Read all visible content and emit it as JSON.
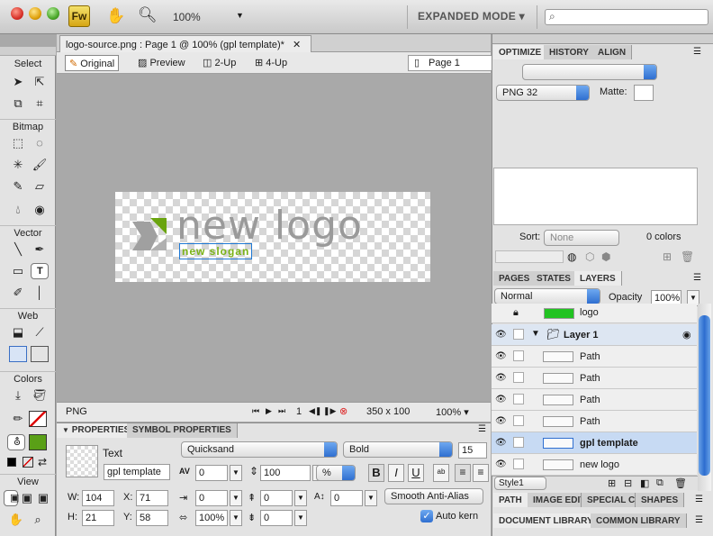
{
  "app": {
    "logo": "Fw",
    "zoom": "100%",
    "mode": "EXPANDED MODE"
  },
  "document": {
    "tab_title": "logo-source.png : Page 1 @ 100% (gpl template)*",
    "views": [
      "Original",
      "Preview",
      "2-Up",
      "4-Up"
    ],
    "page_select": "Page 1",
    "canvas_logo_text": "new logo",
    "canvas_slogan_text": "new slogan"
  },
  "tools": {
    "sections": [
      "Select",
      "Bitmap",
      "Vector",
      "Web",
      "Colors",
      "View"
    ]
  },
  "status": {
    "format": "PNG",
    "frame": "1",
    "size": "350 x 100",
    "zoom": "100%"
  },
  "properties": {
    "tabs": [
      "PROPERTIES",
      "SYMBOL PROPERTIES"
    ],
    "object_type": "Text",
    "object_name": "gpl template",
    "font": "Quicksand",
    "style": "Bold",
    "size": "15",
    "tracking": "0",
    "leading": "100",
    "leading_unit": "%",
    "w_label": "W:",
    "w": "104",
    "x_label": "X:",
    "x": "71",
    "h_label": "H:",
    "h": "21",
    "y_label": "Y:",
    "y": "58",
    "indent": "0",
    "space_before": "0",
    "baseline_shift": "0",
    "horiz_scale": "100%",
    "space_after": "0",
    "antialias": "Smooth Anti-Alias",
    "autokern_label": "Auto kern",
    "bold": "B",
    "italic": "I",
    "underline": "U"
  },
  "optimize": {
    "tabs": [
      "OPTIMIZE",
      "HISTORY",
      "ALIGN"
    ],
    "format": "PNG 32",
    "matte_label": "Matte:",
    "sort_label": "Sort:",
    "sort_value": "None",
    "colors_count": "0 colors"
  },
  "layers_panel": {
    "tabs": [
      "PAGES",
      "STATES",
      "LAYERS"
    ],
    "blend_mode": "Normal",
    "opacity_label": "Opacity",
    "opacity": "100%",
    "rows": [
      "logo",
      "Layer 1",
      "Path",
      "Path",
      "Path",
      "Path",
      "gpl template",
      "new logo"
    ],
    "style": "Style1"
  },
  "bottom_tabs": {
    "row1": [
      "PATH",
      "IMAGE EDIT",
      "SPECIAL CH",
      "SHAPES"
    ],
    "row2": [
      "DOCUMENT LIBRARY",
      "COMMON LIBRARY"
    ]
  },
  "colors": {
    "accent_blue": "#2f6fd0",
    "fill_swatch": "#5aa017",
    "logo_green": "#7ab317",
    "selection_blue": "#c7daf3"
  }
}
